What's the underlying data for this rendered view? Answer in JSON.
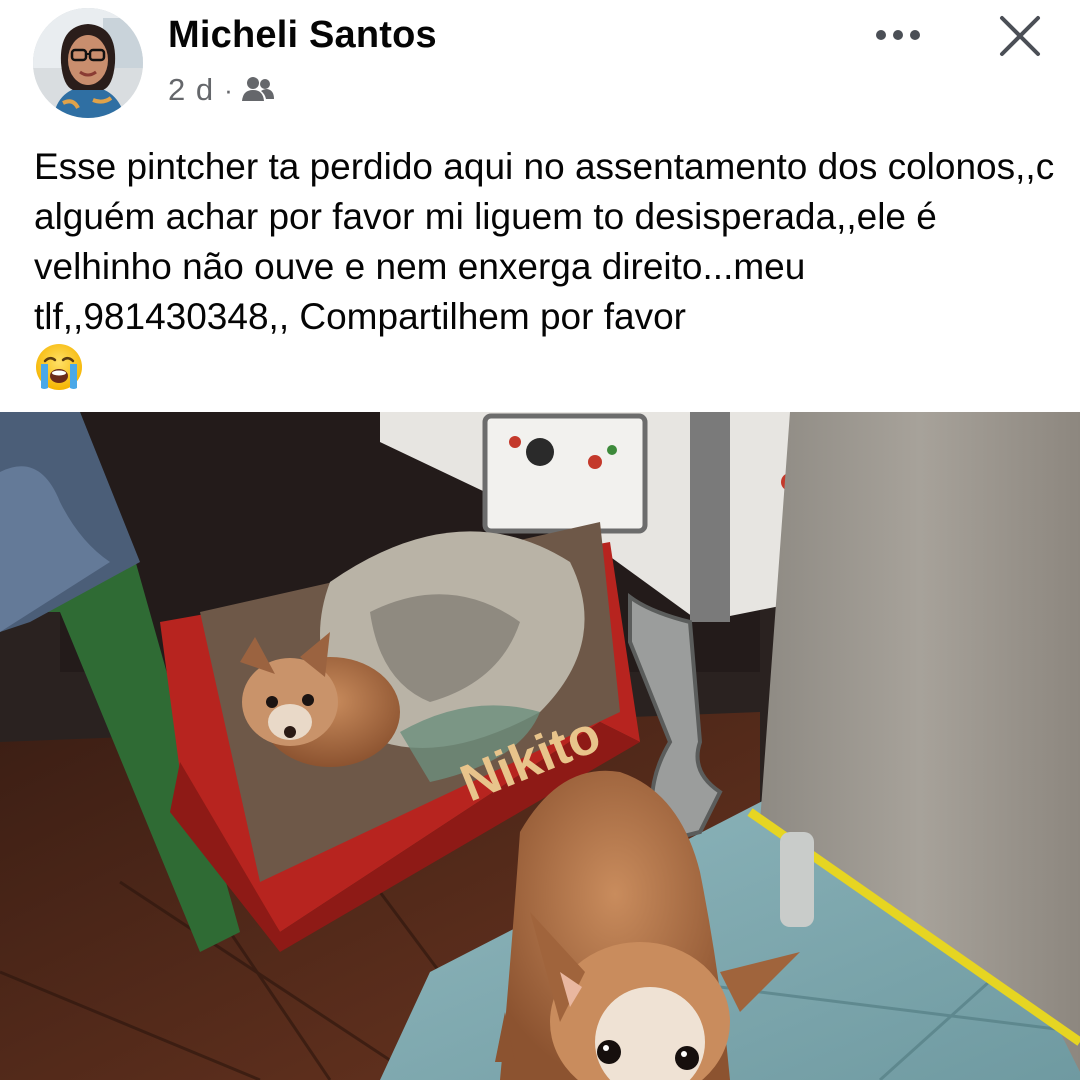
{
  "post": {
    "author": {
      "name": "Micheli Santos",
      "avatar_icon": "profile-photo"
    },
    "timestamp": "2 d",
    "separator": "·",
    "audience_icon": "friends-icon",
    "actions": {
      "more_icon": "more-options-icon",
      "close_icon": "close-icon"
    },
    "text": "Esse pintcher ta perdido aqui no assentamento dos colonos,,c alguém achar por favor mi liguem to desisperada,,ele é velhinho não ouve e nem enxerga direito...meu tlf,,981430348,, Compartilhem por favor",
    "emoji": "loudly-crying-face",
    "photo": {
      "box_label": "Nikito"
    }
  },
  "colors": {
    "name_text": "#050505",
    "meta_text": "#65676b",
    "background": "#ffffff"
  }
}
